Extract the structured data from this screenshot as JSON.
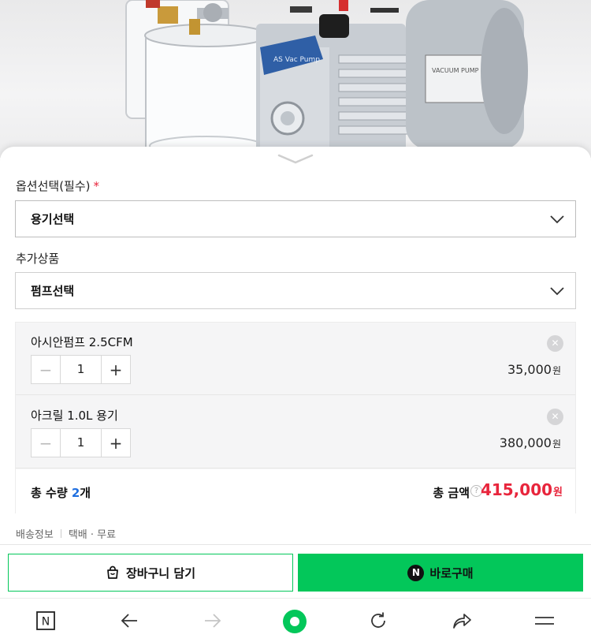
{
  "option_section": {
    "label": "옵션선택(필수)",
    "required_mark": "*",
    "select_value": "용기선택"
  },
  "addon_section": {
    "label": "추가상품",
    "select_value": "펌프선택"
  },
  "cart_items": [
    {
      "name": "아시안펌프 2.5CFM",
      "quantity": "1",
      "price": "35,000",
      "currency": "원"
    },
    {
      "name": "아크릴 1.0L 용기",
      "quantity": "1",
      "price": "380,000",
      "currency": "원"
    }
  ],
  "summary": {
    "total_qty_label": "총 수량",
    "total_qty": "2",
    "total_qty_unit": "개",
    "total_amount_label": "총 금액",
    "help_mark": "?",
    "total_amount": "415,000",
    "currency": "원"
  },
  "shipping": {
    "label": "배송정보",
    "value": "택배 · 무료"
  },
  "actions": {
    "cart_label": "장바구니 담기",
    "buy_label": "바로구매",
    "npay_mark": "N"
  },
  "toolbar": {
    "home_mark": "N",
    "icons": [
      "naver-home-icon",
      "back-arrow-icon",
      "forward-arrow-icon",
      "green-dot-icon",
      "reload-icon",
      "share-icon",
      "menu-icon"
    ]
  },
  "colors": {
    "brand_green": "#03c75a",
    "price_red": "#e8253c",
    "qty_blue": "#1f6fe0"
  }
}
